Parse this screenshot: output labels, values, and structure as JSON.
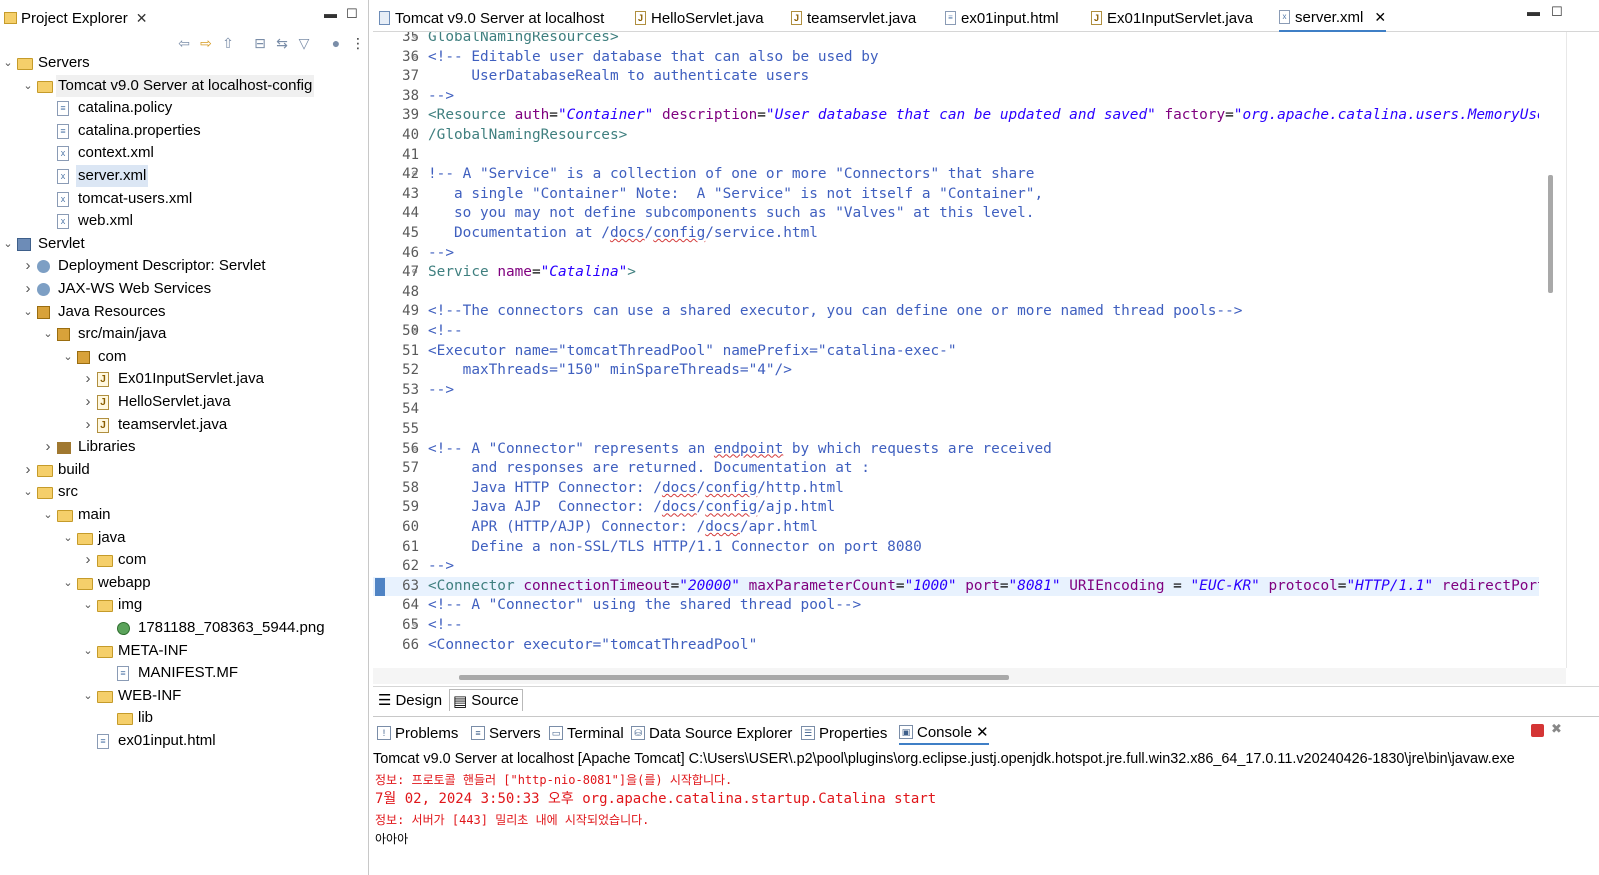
{
  "explorer": {
    "title": "Project Explorer",
    "tree": [
      {
        "label": "Servers",
        "depth": 0,
        "twisty": "open",
        "icon": "folder"
      },
      {
        "label": "Tomcat v9.0 Server at localhost-config",
        "depth": 1,
        "twisty": "open",
        "icon": "folder",
        "hl": true
      },
      {
        "label": "catalina.policy",
        "depth": 2,
        "twisty": "none",
        "icon": "file"
      },
      {
        "label": "catalina.properties",
        "depth": 2,
        "twisty": "none",
        "icon": "file"
      },
      {
        "label": "context.xml",
        "depth": 2,
        "twisty": "none",
        "icon": "xml"
      },
      {
        "label": "server.xml",
        "depth": 2,
        "twisty": "none",
        "icon": "xml",
        "sel": true
      },
      {
        "label": "tomcat-users.xml",
        "depth": 2,
        "twisty": "none",
        "icon": "xml"
      },
      {
        "label": "web.xml",
        "depth": 2,
        "twisty": "none",
        "icon": "xml"
      },
      {
        "label": "Servlet",
        "depth": 0,
        "twisty": "open",
        "icon": "project"
      },
      {
        "label": "Deployment Descriptor: Servlet",
        "depth": 1,
        "twisty": "closed",
        "icon": "gear"
      },
      {
        "label": "JAX-WS Web Services",
        "depth": 1,
        "twisty": "closed",
        "icon": "gear"
      },
      {
        "label": "Java Resources",
        "depth": 1,
        "twisty": "open",
        "icon": "pkg"
      },
      {
        "label": "src/main/java",
        "depth": 2,
        "twisty": "open",
        "icon": "pkg"
      },
      {
        "label": "com",
        "depth": 3,
        "twisty": "open",
        "icon": "pkg"
      },
      {
        "label": "Ex01InputServlet.java",
        "depth": 4,
        "twisty": "closed",
        "icon": "java"
      },
      {
        "label": "HelloServlet.java",
        "depth": 4,
        "twisty": "closed",
        "icon": "java"
      },
      {
        "label": "teamservlet.java",
        "depth": 4,
        "twisty": "closed",
        "icon": "java"
      },
      {
        "label": "Libraries",
        "depth": 2,
        "twisty": "closed",
        "icon": "lib"
      },
      {
        "label": "build",
        "depth": 1,
        "twisty": "closed",
        "icon": "folder"
      },
      {
        "label": "src",
        "depth": 1,
        "twisty": "open",
        "icon": "folder"
      },
      {
        "label": "main",
        "depth": 2,
        "twisty": "open",
        "icon": "folder"
      },
      {
        "label": "java",
        "depth": 3,
        "twisty": "open",
        "icon": "folder"
      },
      {
        "label": "com",
        "depth": 4,
        "twisty": "closed",
        "icon": "folder"
      },
      {
        "label": "webapp",
        "depth": 3,
        "twisty": "open",
        "icon": "folder"
      },
      {
        "label": "img",
        "depth": 4,
        "twisty": "open",
        "icon": "folder"
      },
      {
        "label": "1781188_708363_5944.png",
        "depth": 5,
        "twisty": "none",
        "icon": "globe"
      },
      {
        "label": "META-INF",
        "depth": 4,
        "twisty": "open",
        "icon": "folder"
      },
      {
        "label": "MANIFEST.MF",
        "depth": 5,
        "twisty": "none",
        "icon": "file"
      },
      {
        "label": "WEB-INF",
        "depth": 4,
        "twisty": "open",
        "icon": "folder"
      },
      {
        "label": "lib",
        "depth": 5,
        "twisty": "none",
        "icon": "folder"
      },
      {
        "label": "ex01input.html",
        "depth": 4,
        "twisty": "none",
        "icon": "file"
      }
    ]
  },
  "editor": {
    "tabs": [
      {
        "label": "Tomcat v9.0 Server at localhost",
        "icon": "server"
      },
      {
        "label": "HelloServlet.java",
        "icon": "java"
      },
      {
        "label": "teamservlet.java",
        "icon": "java"
      },
      {
        "label": "ex01input.html",
        "icon": "file"
      },
      {
        "label": "Ex01InputServlet.java",
        "icon": "java"
      },
      {
        "label": "server.xml",
        "icon": "xml",
        "active": true
      }
    ],
    "bottom_tabs": [
      "Design",
      "Source"
    ],
    "active_bottom_tab": "Source",
    "lines": [
      {
        "n": "35",
        "fold": "⊖",
        "segs": [
          [
            "tag",
            "GlobalNamingResources>"
          ]
        ]
      },
      {
        "n": "36",
        "fold": "⊖",
        "segs": [
          [
            "com",
            "<!-- Editable user database that can also be used by"
          ]
        ]
      },
      {
        "n": "37",
        "fold": "",
        "segs": [
          [
            "com",
            "     UserDatabaseRealm to authenticate users"
          ]
        ]
      },
      {
        "n": "38",
        "fold": "",
        "segs": [
          [
            "com",
            "-->"
          ]
        ]
      },
      {
        "n": "39",
        "fold": "",
        "segs": [
          [
            "tag",
            "<Resource "
          ],
          [
            "attr",
            "auth"
          ],
          [
            "plain",
            "="
          ],
          [
            "val",
            "\"Container\" "
          ],
          [
            "attr",
            "description"
          ],
          [
            "plain",
            "="
          ],
          [
            "val",
            "\"User database that can be updated and saved\" "
          ],
          [
            "attr",
            "factory"
          ],
          [
            "plain",
            "="
          ],
          [
            "val",
            "\"org.apache.catalina.users.MemoryUserDatabaseFactory\""
          ]
        ]
      },
      {
        "n": "40",
        "fold": "",
        "segs": [
          [
            "tag",
            "/GlobalNamingResources>"
          ]
        ]
      },
      {
        "n": "41",
        "fold": "",
        "segs": []
      },
      {
        "n": "42",
        "fold": "⊖",
        "segs": [
          [
            "com",
            "!-- A \"Service\" is a collection of one or more \"Connectors\" that share"
          ]
        ]
      },
      {
        "n": "43",
        "fold": "",
        "segs": [
          [
            "com",
            "   a single \"Container\" Note:  A \"Service\" is not itself a \"Container\","
          ]
        ]
      },
      {
        "n": "44",
        "fold": "",
        "segs": [
          [
            "com",
            "   so you may not define subcomponents such as \"Valves\" at this level."
          ]
        ]
      },
      {
        "n": "45",
        "fold": "",
        "segs": [
          [
            "com",
            "   Documentation at /docs/config/service.html"
          ]
        ]
      },
      {
        "n": "46",
        "fold": "",
        "segs": [
          [
            "com",
            "-->"
          ]
        ]
      },
      {
        "n": "47",
        "fold": "⊖",
        "segs": [
          [
            "tag",
            "Service "
          ],
          [
            "attr",
            "name"
          ],
          [
            "plain",
            "="
          ],
          [
            "val",
            "\"Catalina\""
          ],
          [
            "tag",
            ">"
          ]
        ]
      },
      {
        "n": "48",
        "fold": "",
        "segs": []
      },
      {
        "n": "49",
        "fold": "",
        "segs": [
          [
            "com",
            "<!--The connectors can use a shared executor, you can define one or more named thread pools-->"
          ]
        ]
      },
      {
        "n": "50",
        "fold": "⊖",
        "segs": [
          [
            "com",
            "<!--"
          ]
        ]
      },
      {
        "n": "51",
        "fold": "",
        "segs": [
          [
            "com",
            "<Executor name=\"tomcatThreadPool\" namePrefix=\"catalina-exec-\""
          ]
        ]
      },
      {
        "n": "52",
        "fold": "",
        "segs": [
          [
            "com",
            "    maxThreads=\"150\" minSpareThreads=\"4\"/>"
          ]
        ]
      },
      {
        "n": "53",
        "fold": "",
        "segs": [
          [
            "com",
            "-->"
          ]
        ]
      },
      {
        "n": "54",
        "fold": "",
        "segs": []
      },
      {
        "n": "55",
        "fold": "",
        "segs": []
      },
      {
        "n": "56",
        "fold": "⊖",
        "segs": [
          [
            "com",
            "<!-- A \"Connector\" represents an endpoint by which requests are received"
          ]
        ]
      },
      {
        "n": "57",
        "fold": "",
        "segs": [
          [
            "com",
            "     and responses are returned. Documentation at :"
          ]
        ]
      },
      {
        "n": "58",
        "fold": "",
        "segs": [
          [
            "com",
            "     Java HTTP Connector: /docs/config/http.html"
          ]
        ]
      },
      {
        "n": "59",
        "fold": "",
        "segs": [
          [
            "com",
            "     Java AJP  Connector: /docs/config/ajp.html"
          ]
        ]
      },
      {
        "n": "60",
        "fold": "",
        "segs": [
          [
            "com",
            "     APR (HTTP/AJP) Connector: /docs/apr.html"
          ]
        ]
      },
      {
        "n": "61",
        "fold": "",
        "segs": [
          [
            "com",
            "     Define a non-SSL/TLS HTTP/1.1 Connector on port 8080"
          ]
        ]
      },
      {
        "n": "62",
        "fold": "",
        "segs": [
          [
            "com",
            "-->"
          ]
        ]
      },
      {
        "n": "63",
        "fold": "",
        "cur": true,
        "segs": [
          [
            "tag",
            "<Connector "
          ],
          [
            "attr",
            "connectionTimeout"
          ],
          [
            "plain",
            "="
          ],
          [
            "val",
            "\"20000\" "
          ],
          [
            "attr",
            "maxParameterCount"
          ],
          [
            "plain",
            "="
          ],
          [
            "val",
            "\"1000\" "
          ],
          [
            "attr",
            "port"
          ],
          [
            "plain",
            "="
          ],
          [
            "val",
            "\"8081\" "
          ],
          [
            "attr",
            "URIEncoding "
          ],
          [
            "plain",
            "= "
          ],
          [
            "val",
            "\"EUC-KR\" "
          ],
          [
            "attr",
            "protocol"
          ],
          [
            "plain",
            "="
          ],
          [
            "val",
            "\"HTTP/1.1\" "
          ],
          [
            "attr",
            "redirectPort"
          ]
        ]
      },
      {
        "n": "64",
        "fold": "",
        "segs": [
          [
            "com",
            "<!-- A \"Connector\" using the shared thread pool-->"
          ]
        ]
      },
      {
        "n": "65",
        "fold": "⊖",
        "segs": [
          [
            "com",
            "<!--"
          ]
        ]
      },
      {
        "n": "66",
        "fold": "",
        "segs": [
          [
            "com",
            "<Connector executor=\"tomcatThreadPool\""
          ]
        ]
      }
    ]
  },
  "console": {
    "tabs": [
      "Problems",
      "Servers",
      "Terminal",
      "Data Source Explorer",
      "Properties",
      "Console"
    ],
    "active_tab": "Console",
    "header": "Tomcat v9.0 Server at localhost [Apache Tomcat] C:\\Users\\USER\\.p2\\pool\\plugins\\org.eclipse.justj.openjdk.hotspot.jre.full.win32.x86_64_17.0.11.v20240426-1830\\jre\\bin\\javaw.exe",
    "lines": [
      "정보: 프로토콜 핸들러 [\"http-nio-8081\"]을(를) 시작합니다.",
      "7월 02, 2024 3:50:33 오후 org.apache.catalina.startup.Catalina start",
      "정보: 서버가 [443] 밀리초 내에 시작되었습니다.",
      "아아아"
    ]
  },
  "colors": {
    "comment": "#3f5fbf",
    "tag": "#3f7f7f",
    "attribute": "#7f007f",
    "value": "#2a00ff",
    "console_error": "#e0161a",
    "selection": "#dbe6f4",
    "current_line": "#e8f2fe"
  }
}
